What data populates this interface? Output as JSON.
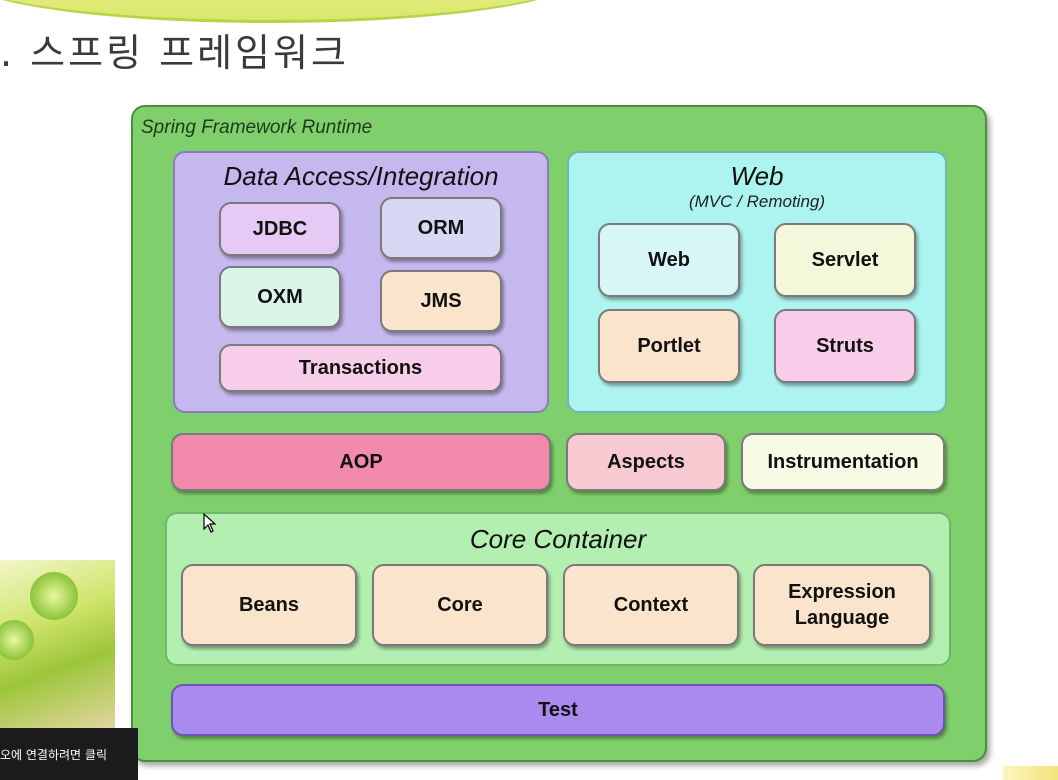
{
  "slide": {
    "title": ". 스프링 프레임워크"
  },
  "runtime": {
    "label": "Spring Framework Runtime"
  },
  "data_access": {
    "title": "Data Access/Integration",
    "modules": {
      "jdbc": "JDBC",
      "orm": "ORM",
      "oxm": "OXM",
      "jms": "JMS",
      "transactions": "Transactions"
    }
  },
  "web": {
    "title": "Web",
    "subtitle": "(MVC / Remoting)",
    "modules": {
      "web": "Web",
      "servlet": "Servlet",
      "portlet": "Portlet",
      "struts": "Struts"
    }
  },
  "middle": {
    "aop": "AOP",
    "aspects": "Aspects",
    "instrumentation": "Instrumentation"
  },
  "core_container": {
    "title": "Core Container",
    "modules": {
      "beans": "Beans",
      "core": "Core",
      "context": "Context",
      "expression": "Expression Language"
    }
  },
  "test": "Test",
  "caption": "오에 연결하려면 클릭",
  "colors": {
    "runtime": "#7fd06c",
    "data_access_panel": "#c5b8ee",
    "web_panel": "#adf3ef",
    "core_panel": "#b3efb0",
    "aop": "#f28bab",
    "aspects": "#f7c9d0",
    "instrumentation": "#f7fbe6",
    "test": "#a98bf0"
  }
}
